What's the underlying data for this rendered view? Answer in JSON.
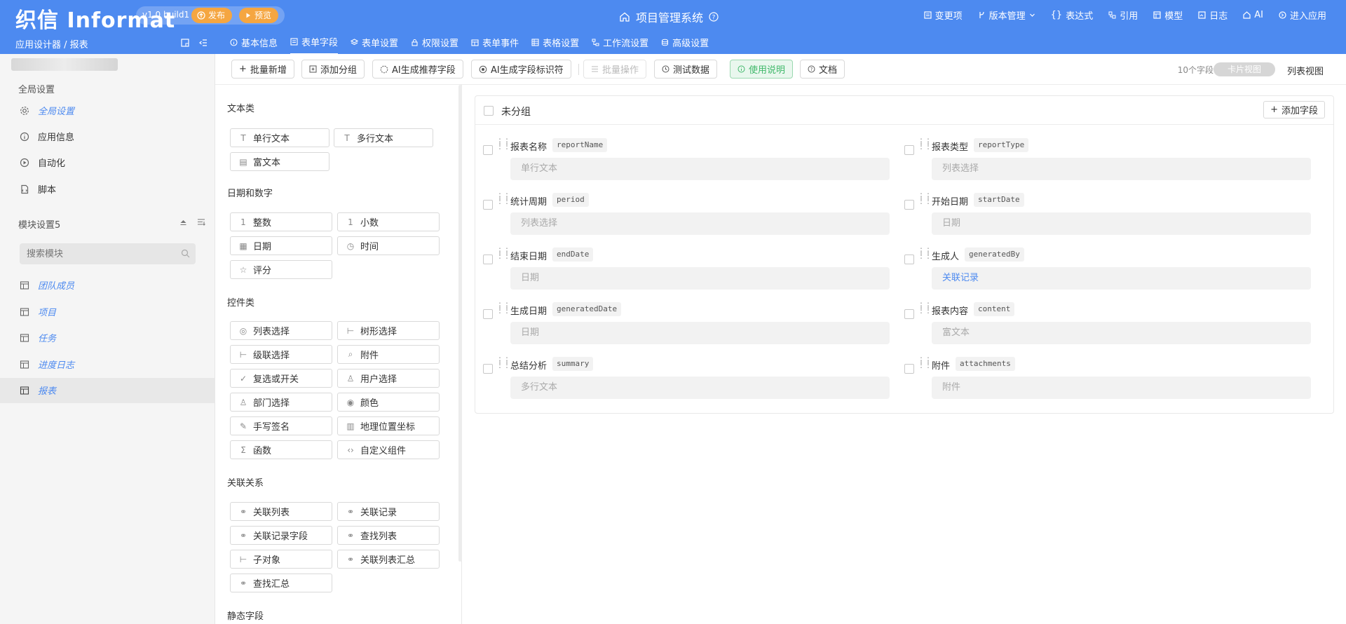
{
  "header": {
    "logo": "织信 Informat",
    "version": "v1.0 build1",
    "publish_label": "发布",
    "preview_label": "预览",
    "app_title": "项目管理系统",
    "actions": [
      {
        "label": "变更项",
        "icon": "changes-icon"
      },
      {
        "label": "版本管理",
        "icon": "version-icon"
      },
      {
        "label": "表达式",
        "icon": "expression-icon"
      },
      {
        "label": "引用",
        "icon": "reference-icon"
      },
      {
        "label": "模型",
        "icon": "model-icon"
      },
      {
        "label": "日志",
        "icon": "log-icon"
      },
      {
        "label": "AI",
        "icon": "ai-icon"
      },
      {
        "label": "进入应用",
        "icon": "enter-app-icon"
      }
    ],
    "breadcrumb": "应用设计器 / 报表",
    "tabs": [
      {
        "label": "基本信息",
        "icon": "info-icon"
      },
      {
        "label": "表单字段",
        "icon": "form-field-icon"
      },
      {
        "label": "表单设置",
        "icon": "form-setting-icon"
      },
      {
        "label": "权限设置",
        "icon": "lock-icon"
      },
      {
        "label": "表单事件",
        "icon": "event-icon"
      },
      {
        "label": "表格设置",
        "icon": "table-icon"
      },
      {
        "label": "工作流设置",
        "icon": "workflow-icon"
      },
      {
        "label": "高级设置",
        "icon": "advanced-icon"
      }
    ],
    "active_tab": "表单字段"
  },
  "sidebar": {
    "global_heading": "全局设置",
    "global_items": [
      {
        "label": "全局设置",
        "icon": "gear-icon",
        "link": true
      },
      {
        "label": "应用信息",
        "icon": "info-icon",
        "link": false
      },
      {
        "label": "自动化",
        "icon": "automation-icon",
        "link": false
      },
      {
        "label": "脚本",
        "icon": "script-icon",
        "link": false
      }
    ],
    "module_heading": "模块设置5",
    "search_placeholder": "搜索模块",
    "modules": [
      {
        "label": "团队成员"
      },
      {
        "label": "项目"
      },
      {
        "label": "任务"
      },
      {
        "label": "进度日志"
      },
      {
        "label": "报表"
      }
    ],
    "active_module": "报表"
  },
  "toolbar": {
    "buttons": [
      "批量新增",
      "添加分组",
      "AI生成推荐字段",
      "AI生成字段标识符",
      "批量操作",
      "测试数据",
      "使用说明",
      "文档"
    ],
    "field_count": "10个字段",
    "card_view": "卡片视图",
    "list_view": "列表视图"
  },
  "palette": {
    "groups": [
      {
        "heading": "文本类",
        "items": [
          "单行文本",
          "多行文本",
          "富文本"
        ]
      },
      {
        "heading": "日期和数字",
        "items": [
          "整数",
          "小数",
          "日期",
          "时间",
          "评分"
        ]
      },
      {
        "heading": "控件类",
        "items": [
          "列表选择",
          "树形选择",
          "级联选择",
          "附件",
          "复选或开关",
          "用户选择",
          "部门选择",
          "颜色",
          "手写签名",
          "地理位置坐标",
          "函数",
          "自定义组件"
        ]
      },
      {
        "heading": "关联关系",
        "items": [
          "关联列表",
          "关联记录",
          "关联记录字段",
          "查找列表",
          "子对象",
          "关联列表汇总",
          "查找汇总"
        ]
      },
      {
        "heading": "静态字段",
        "items": []
      }
    ]
  },
  "canvas": {
    "group_title": "未分组",
    "add_field_label": "添加字段",
    "fields": [
      {
        "label": "报表名称",
        "code": "reportName",
        "type": "单行文本"
      },
      {
        "label": "报表类型",
        "code": "reportType",
        "type": "列表选择"
      },
      {
        "label": "统计周期",
        "code": "period",
        "type": "列表选择"
      },
      {
        "label": "开始日期",
        "code": "startDate",
        "type": "日期"
      },
      {
        "label": "结束日期",
        "code": "endDate",
        "type": "日期"
      },
      {
        "label": "生成人",
        "code": "generatedBy",
        "type": "关联记录"
      },
      {
        "label": "生成日期",
        "code": "generatedDate",
        "type": "日期"
      },
      {
        "label": "报表内容",
        "code": "content",
        "type": "富文本"
      },
      {
        "label": "总结分析",
        "code": "summary",
        "type": "多行文本"
      },
      {
        "label": "附件",
        "code": "attachments",
        "type": "附件"
      }
    ]
  },
  "colors": {
    "primary": "#4d8af0",
    "publish": "#f5a641",
    "link": "#4d8af0",
    "success": "#3fb86a"
  }
}
